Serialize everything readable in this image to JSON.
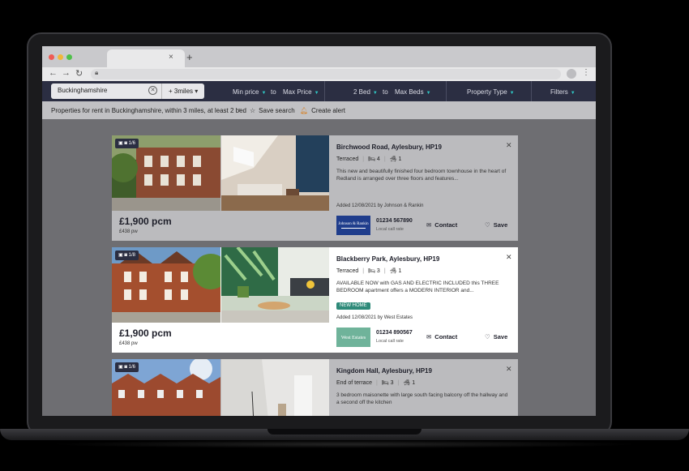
{
  "browser": {
    "tab_close": "×",
    "new_tab": "+",
    "back": "←",
    "forward": "→",
    "reload": "↻",
    "menu": "⋮"
  },
  "search": {
    "location": "Buckinghamshire",
    "radius": "+ 3miles",
    "min_price": "Min price",
    "to1": "to",
    "max_price": "Max Price",
    "min_beds": "2 Bed",
    "to2": "to",
    "max_beds": "Max Beds",
    "property_type": "Property Type",
    "filters": "Filters"
  },
  "breadcrumb": {
    "text": "Properties for rent in Buckinghamshire, within 3 miles, at least 2 bed",
    "save_search": "Save search",
    "create_alert": "Create alert"
  },
  "listings": [
    {
      "photo_count": "1/6",
      "price": "£1,900 pcm",
      "price_pw": "£438 pw",
      "title": "Birchwood Road, Aylesbury, HP19",
      "type": "Terraced",
      "beds": "4",
      "baths": "1",
      "description": "This new and beautifully finished four bedroom townhouse in the heart of Redland is arranged over three floors and features...",
      "added": "Added 12/08/2021 by Johnson & Rankin",
      "agent_logo": "Johnson & Rankin",
      "phone": "01234 567890",
      "rate": "Local call rate",
      "contact": "Contact",
      "save": "Save"
    },
    {
      "photo_count": "1/8",
      "price": "£1,900 pcm",
      "price_pw": "£438 pw",
      "title": "Blackberry Park, Aylesbury, HP19",
      "type": "Terraced",
      "beds": "3",
      "baths": "1",
      "description": "AVAILABLE NOW with GAS AND ELECTRIC INCLUDED this THREE BEDROOM apartment offers a MODERN INTERIOR and...",
      "tag": "NEW HOME",
      "added": "Added 12/08/2021 by West Estates",
      "agent_logo": "West Estates",
      "phone": "01234 890567",
      "rate": "Local call rate",
      "contact": "Contact",
      "save": "Save"
    },
    {
      "photo_count": "1/6",
      "title": "Kingdom Hall, Aylesbury, HP19",
      "type": "End of terrace",
      "beds": "3",
      "baths": "1",
      "description": "3 bedroom maisonette with large south facing balcony off the hallway and a second off the kitchen"
    }
  ],
  "colors": {
    "nav_bg": "#2b2e42",
    "accent": "#2fc6c3",
    "tag_bg": "#2e8a79"
  }
}
